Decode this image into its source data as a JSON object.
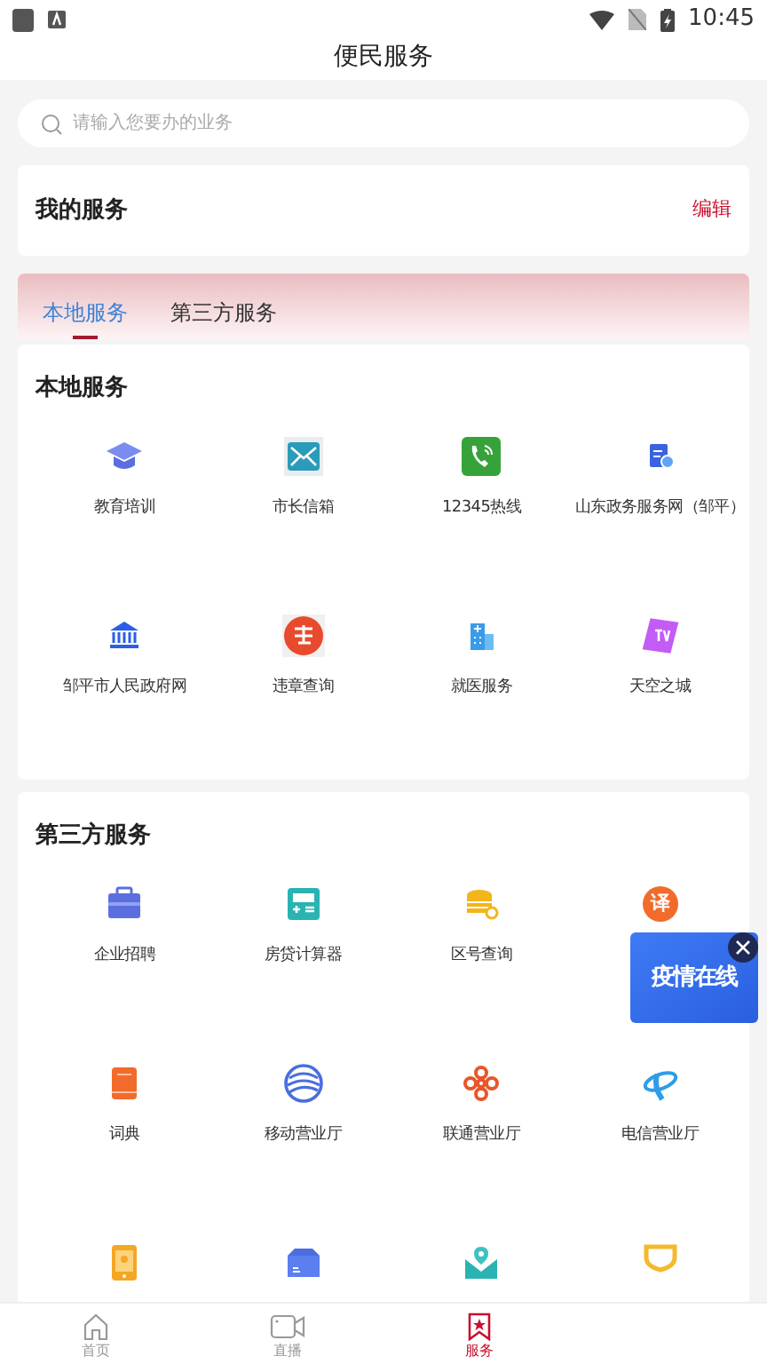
{
  "status_bar": {
    "time": "10:45"
  },
  "header": {
    "title": "便民服务"
  },
  "search": {
    "placeholder": "请输入您要办的业务"
  },
  "my_services": {
    "title": "我的服务",
    "edit": "编辑"
  },
  "tabs": [
    {
      "label": "本地服务",
      "selected": true
    },
    {
      "label": "第三方服务",
      "selected": false
    }
  ],
  "sections": [
    {
      "title": "本地服务",
      "items": [
        {
          "kind": "labeled",
          "label": "教育培训"
        },
        {
          "kind": "labeled",
          "label": "市长信箱"
        },
        {
          "kind": "labeled",
          "label": "12345热线"
        },
        {
          "kind": "labeled",
          "label": "山东政务服务网（邹平）"
        },
        {
          "kind": "labeled",
          "label": "邹平市人民政府网"
        },
        {
          "kind": "labeled",
          "label": "违章查询"
        },
        {
          "kind": "labeled",
          "label": "就医服务"
        },
        {
          "kind": "labeled",
          "label": "天空之城"
        }
      ]
    },
    {
      "title": "第三方服务",
      "items": [
        {
          "kind": "labeled",
          "label": "企业招聘"
        },
        {
          "kind": "labeled",
          "label": "房贷计算器"
        },
        {
          "kind": "labeled",
          "label": "区号查询"
        },
        {
          "kind": "glyph",
          "icon_text": "译"
        },
        {
          "kind": "labeled",
          "label": "词典"
        },
        {
          "kind": "labeled",
          "label": "移动营业厅"
        },
        {
          "kind": "labeled",
          "label": "联通营业厅"
        },
        {
          "kind": "labeled",
          "label": "电信营业厅"
        },
        {
          "kind": "icon"
        },
        {
          "kind": "icon"
        },
        {
          "kind": "icon"
        },
        {
          "kind": "icon"
        }
      ]
    }
  ],
  "floating_banner": {
    "text": "疫情在线"
  },
  "bottom_nav": [
    {
      "label": "首页",
      "selected": false
    },
    {
      "label": "直播",
      "selected": false
    },
    {
      "label": "服务",
      "selected": true
    }
  ]
}
